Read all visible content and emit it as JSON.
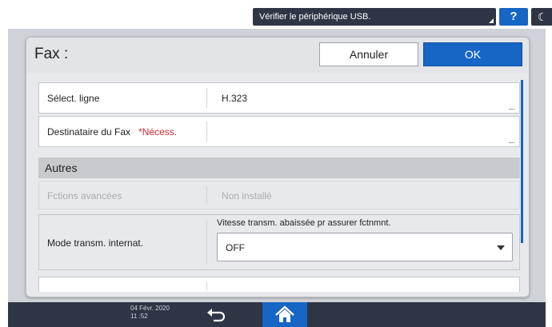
{
  "status_bar": {
    "message": "Vérifier le périphérique USB.",
    "help_label": "?",
    "moon_label": "☾"
  },
  "dialog": {
    "title": "Fax :",
    "cancel_label": "Annuler",
    "ok_label": "OK"
  },
  "fields": {
    "line_select": {
      "label": "Sélect. ligne",
      "value": "H.323"
    },
    "fax_recipient": {
      "label": "Destinataire du Fax",
      "required": "*Nécess.",
      "value": ""
    }
  },
  "section": {
    "title": "Autres"
  },
  "advanced": {
    "label": "Fctions avancées",
    "value": "Non installé"
  },
  "mode": {
    "label": "Mode transm. internat.",
    "caption": "Vitesse transm. abaissée pr assurer fctnmnt.",
    "selected": "OFF"
  },
  "bottom_bar": {
    "date": "04 Févr. 2020",
    "time": "11 :52"
  },
  "icons": {
    "back": "back-arrow-icon",
    "home": "home-icon"
  },
  "colors": {
    "accent": "#1765c4",
    "dark_bar": "#2e3545",
    "required": "#d8252c"
  }
}
